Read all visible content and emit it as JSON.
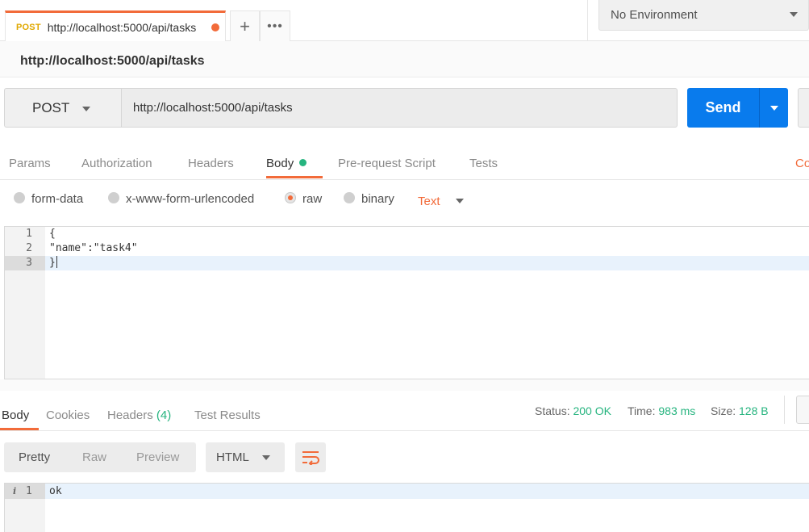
{
  "tab": {
    "method": "POST",
    "url": "http://localhost:5000/api/tasks",
    "add_label": "+",
    "more_label": "•••"
  },
  "environment": {
    "selected": "No Environment"
  },
  "request": {
    "name": "http://localhost:5000/api/tasks",
    "method": "POST",
    "url": "http://localhost:5000/api/tasks",
    "send_label": "Send"
  },
  "request_tabs": {
    "items": [
      {
        "label": "Params"
      },
      {
        "label": "Authorization"
      },
      {
        "label": "Headers"
      },
      {
        "label": "Body"
      },
      {
        "label": "Pre-request Script"
      },
      {
        "label": "Tests"
      }
    ],
    "active": "Body",
    "cookies_label": "Co"
  },
  "body_types": {
    "options": [
      {
        "label": "form-data"
      },
      {
        "label": "x-www-form-urlencoded"
      },
      {
        "label": "raw"
      },
      {
        "label": "binary"
      }
    ],
    "selected": "raw",
    "text_type": "Text"
  },
  "editor": {
    "lines": [
      {
        "num": "1",
        "text": "{"
      },
      {
        "num": "2",
        "text": "\"name\":\"task4\""
      },
      {
        "num": "3",
        "text": "}"
      }
    ]
  },
  "response": {
    "tabs": [
      {
        "label": "Body"
      },
      {
        "label": "Cookies"
      },
      {
        "label": "Headers",
        "count": "(4)"
      },
      {
        "label": "Test Results"
      }
    ],
    "active": "Body",
    "status_label": "Status:",
    "status_value": "200 OK",
    "time_label": "Time:",
    "time_value": "983 ms",
    "size_label": "Size:",
    "size_value": "128 B",
    "views": [
      {
        "label": "Pretty"
      },
      {
        "label": "Raw"
      },
      {
        "label": "Preview"
      }
    ],
    "active_view": "Pretty",
    "format": "HTML",
    "lines": [
      {
        "num": "1",
        "text": "ok",
        "info_marker": "i"
      }
    ]
  },
  "colors": {
    "accent": "#f26b3a",
    "send": "#097bed",
    "success": "#26b47f",
    "method_tag": "#e0a800"
  },
  "icons": {
    "wrap": "wrap-lines-icon",
    "dropdown": "chevron-down-icon"
  }
}
